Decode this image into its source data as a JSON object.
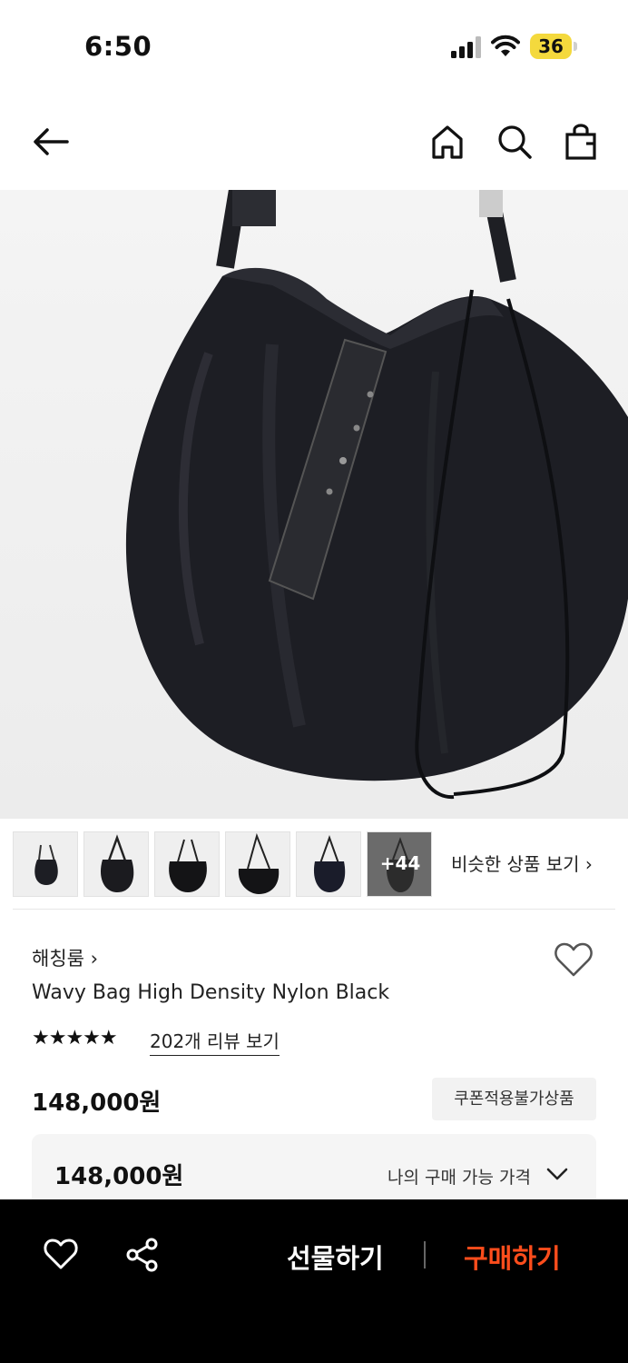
{
  "status_bar": {
    "time": "6:50",
    "battery": "36"
  },
  "nav": {
    "back_icon": "arrow-left-icon",
    "home_icon": "home-icon",
    "search_icon": "search-icon",
    "cart_icon": "shopping-bag-icon"
  },
  "product_image": {
    "icon": "black-nylon-hobo-bag"
  },
  "thumbnails": {
    "more_count": "+44",
    "similar_label": "비슷한 상품 보기 ›"
  },
  "product": {
    "brand": "해칭룸 ›",
    "name": "Wavy Bag High Density Nylon Black",
    "stars": "★★★★★",
    "rating_fraction": 1.0,
    "reviews": "202개 리뷰 보기",
    "price": "148,000원",
    "coupon_badge": "쿠폰적용불가상품"
  },
  "my_price": {
    "price": "148,000원",
    "label": "나의 구매 가능 가격"
  },
  "bottom_bar": {
    "gift": "선물하기",
    "buy": "구매하기"
  },
  "colors": {
    "buy_accent": "#ff4d1c",
    "battery": "#f4d93d"
  }
}
